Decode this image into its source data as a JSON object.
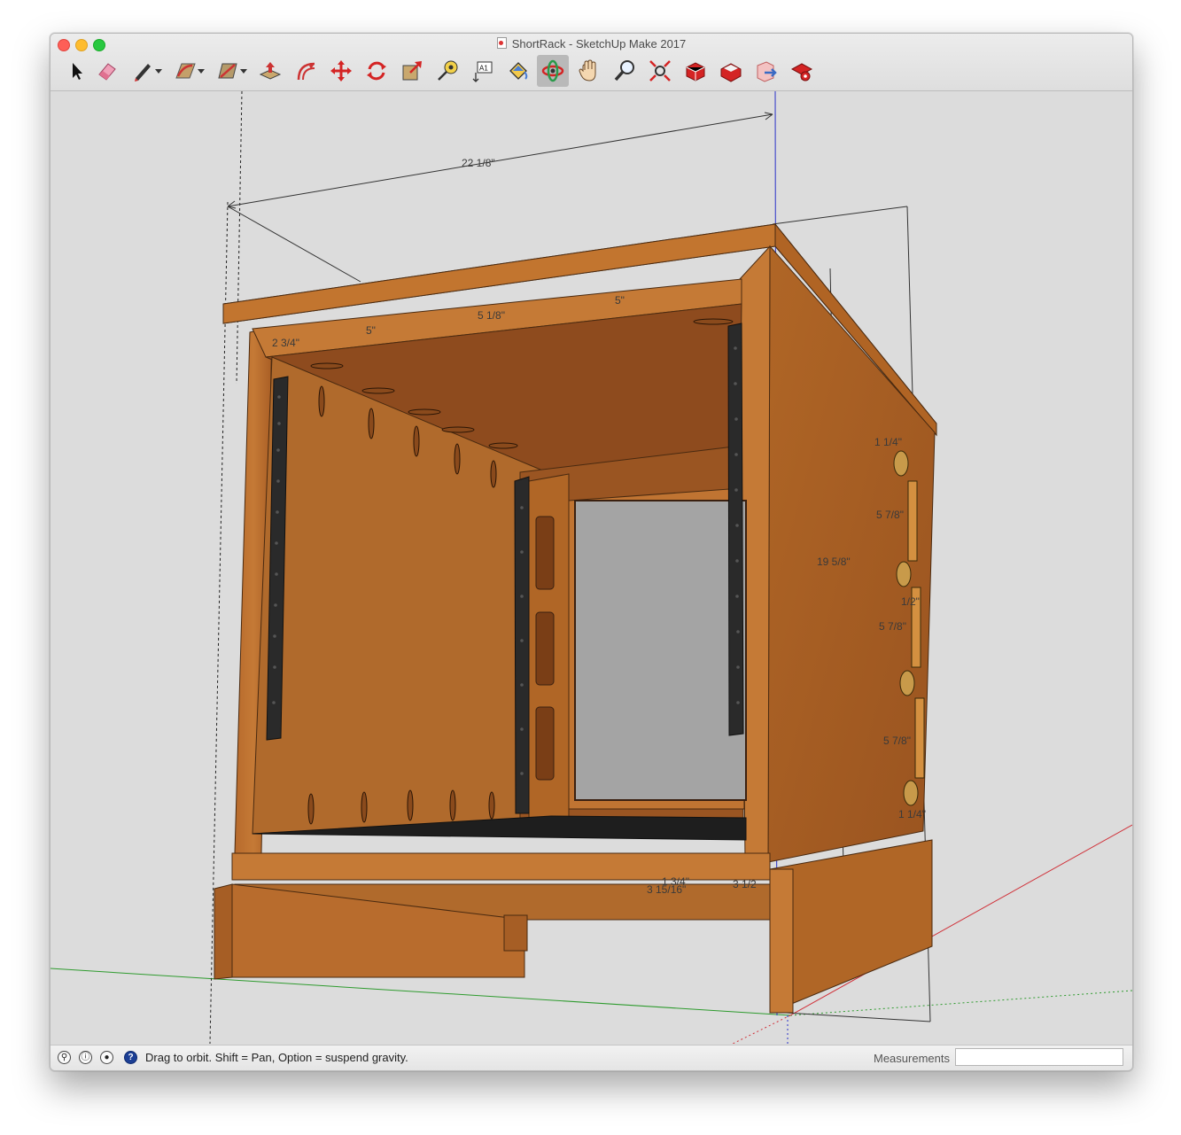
{
  "window": {
    "title": "ShortRack - SketchUp Make 2017"
  },
  "toolbar": {
    "tools": [
      {
        "name": "select-tool",
        "icon": "arrow-cursor-icon"
      },
      {
        "name": "eraser-tool",
        "icon": "eraser-icon"
      },
      {
        "name": "line-tool",
        "icon": "pencil-icon",
        "dropdown": true
      },
      {
        "name": "arc-tool",
        "icon": "arc-icon",
        "dropdown": true
      },
      {
        "name": "rectangle-tool",
        "icon": "rectangle-icon",
        "dropdown": true
      },
      {
        "name": "push-pull-tool",
        "icon": "push-pull-icon"
      },
      {
        "name": "offset-tool",
        "icon": "offset-icon"
      },
      {
        "name": "move-tool",
        "icon": "move-arrows-icon"
      },
      {
        "name": "rotate-tool",
        "icon": "rotate-icon"
      },
      {
        "name": "scale-tool",
        "icon": "scale-icon"
      },
      {
        "name": "tape-measure-tool",
        "icon": "tape-measure-icon"
      },
      {
        "name": "text-tool",
        "icon": "text-label-icon",
        "label": "A1"
      },
      {
        "name": "paint-bucket-tool",
        "icon": "paint-bucket-icon"
      },
      {
        "name": "orbit-tool",
        "icon": "orbit-icon",
        "active": true
      },
      {
        "name": "pan-tool",
        "icon": "hand-icon"
      },
      {
        "name": "zoom-tool",
        "icon": "magnifier-icon"
      },
      {
        "name": "zoom-extents-tool",
        "icon": "zoom-extents-icon"
      },
      {
        "name": "warehouse-tool",
        "icon": "3d-warehouse-icon"
      },
      {
        "name": "extension-warehouse-tool",
        "icon": "extension-warehouse-icon"
      },
      {
        "name": "share-model-tool",
        "icon": "share-model-icon"
      },
      {
        "name": "extension-manager-tool",
        "icon": "extension-manager-icon"
      }
    ]
  },
  "dimensions": {
    "width_total": "22 1/8\"",
    "top_left": "2 3/4\"",
    "top_5a": "5\"",
    "top_5_1_8": "5 1/8\"",
    "top_5b": "5\"",
    "height": "19 5/8\"",
    "bottom_1_3_4": "1 3/4\"",
    "bottom_3_15_16": "3 15/16\"",
    "bottom_3_1_2": "3 1/2",
    "side_1": "1 1/4\"",
    "side_2": "5 7/8\"",
    "side_3": "1/2\"",
    "side_4": "5 7/8\"",
    "side_5": "5 7/8\"",
    "side_6": "1 1/4\""
  },
  "status": {
    "hint": "Drag to orbit. Shift = Pan, Option = suspend gravity.",
    "measurements_label": "Measurements",
    "measurements_value": ""
  },
  "colors": {
    "wood": "#b8672a",
    "wood_dark": "#8a4a1c",
    "rail": "#2a2a2a",
    "background": "#dcdcdc",
    "axis_green": "#2e9b2e",
    "axis_red": "#d0323a",
    "axis_blue": "#2830c8"
  }
}
